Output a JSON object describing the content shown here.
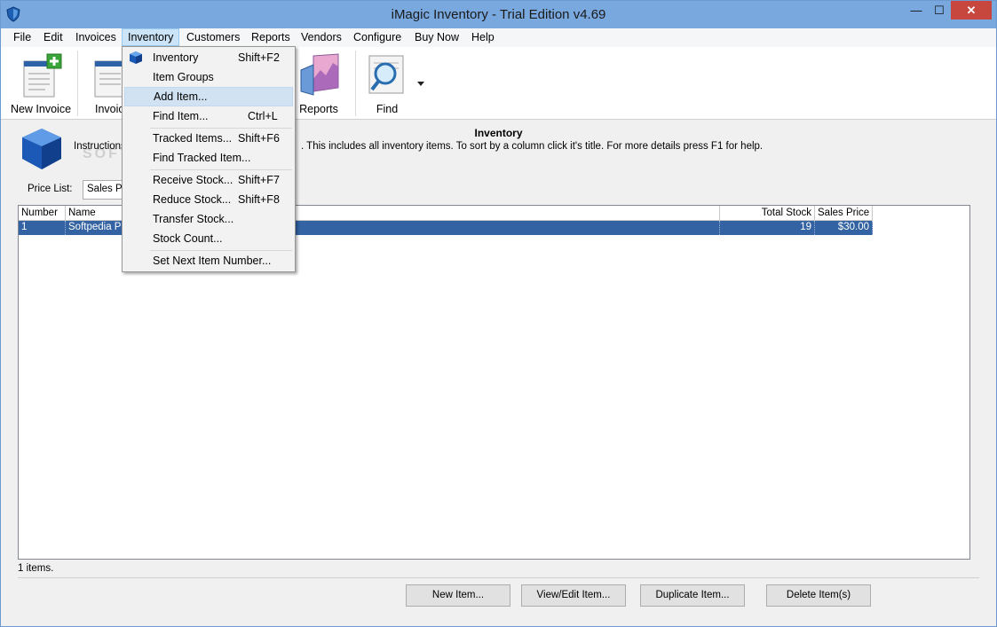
{
  "window": {
    "title": "iMagic Inventory - Trial Edition v4.69",
    "min_glyph": "—",
    "max_glyph": "☐",
    "close_glyph": "✕"
  },
  "menu": [
    "File",
    "Edit",
    "Invoices",
    "Inventory",
    "Customers",
    "Reports",
    "Vendors",
    "Configure",
    "Buy Now",
    "Help"
  ],
  "toolbar": {
    "new_invoice": "New Invoice",
    "invoices_partial": "Invoic",
    "reports": "Reports",
    "find": "Find",
    "watermark": "SOFTPEDIA"
  },
  "header": {
    "title": "Inventory",
    "instructions_start": "Instructions",
    "instructions_end": ". This includes all inventory items. To sort by a column click it's title. For more details press F1 for help."
  },
  "price_list": {
    "label": "Price List:",
    "value": "Sales Pr"
  },
  "table": {
    "columns": [
      "Number",
      "Name",
      "Total Stock",
      "Sales Price"
    ],
    "rows": [
      {
        "number": "1",
        "name": "Softpedia Pr",
        "total_stock": "19",
        "sales_price": "$30.00"
      }
    ]
  },
  "status": "1 items.",
  "buttons": {
    "new_item": "New Item...",
    "view_edit": "View/Edit Item...",
    "duplicate": "Duplicate Item...",
    "delete": "Delete Item(s)"
  },
  "dropdown": [
    {
      "label": "Inventory",
      "shortcut": "Shift+F2"
    },
    {
      "label": "Item Groups",
      "shortcut": ""
    },
    {
      "label": "Add Item...",
      "shortcut": ""
    },
    {
      "label": "Find Item...",
      "shortcut": "Ctrl+L"
    },
    {
      "label": "Tracked Items...",
      "shortcut": "Shift+F6"
    },
    {
      "label": "Find Tracked Item...",
      "shortcut": ""
    },
    {
      "label": "Receive Stock...",
      "shortcut": "Shift+F7"
    },
    {
      "label": "Reduce Stock...",
      "shortcut": "Shift+F8"
    },
    {
      "label": "Transfer Stock...",
      "shortcut": ""
    },
    {
      "label": "Stock Count...",
      "shortcut": ""
    },
    {
      "label": "Set Next Item Number...",
      "shortcut": ""
    }
  ],
  "colors": {
    "titlebar": "#78a8de",
    "selected_row": "#3363a3",
    "close_button": "#c7463d",
    "menu_active": "#cce4f7"
  },
  "icons": [
    "shield-app-icon",
    "new-invoice-icon",
    "invoices-icon",
    "reports-chart-icon",
    "find-magnifier-icon",
    "inventory-cube-icon"
  ]
}
